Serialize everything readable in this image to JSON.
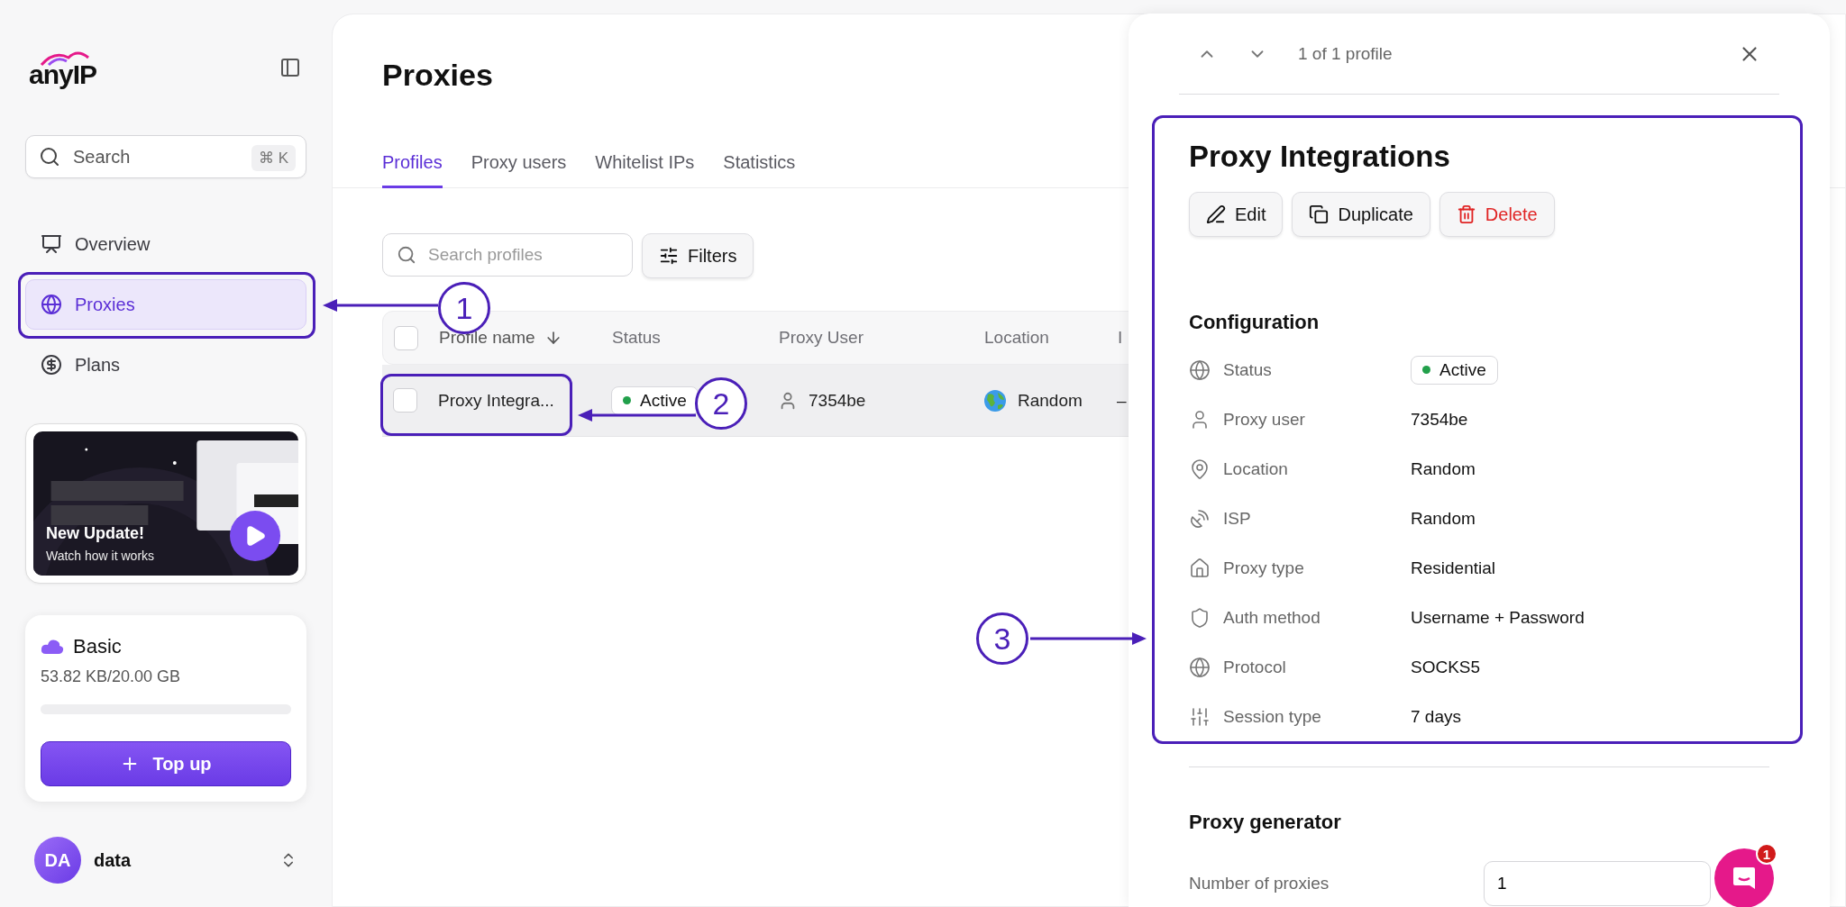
{
  "sidebar": {
    "logo": "anyIP",
    "search": {
      "placeholder": "Search",
      "shortcut": "⌘ K"
    },
    "nav": [
      {
        "label": "Overview",
        "selected": false
      },
      {
        "label": "Proxies",
        "selected": true
      },
      {
        "label": "Plans",
        "selected": false
      }
    ],
    "promo": {
      "title": "New Update!",
      "subtitle": "Watch how it works"
    },
    "plan": {
      "name": "Basic",
      "usage": "53.82 KB/20.00 GB",
      "level": 0,
      "button": "Top up"
    },
    "user": {
      "initials": "DA",
      "name": "data"
    }
  },
  "page": {
    "title": "Proxies",
    "tabs": [
      {
        "label": "Profiles",
        "selected": true
      },
      {
        "label": "Proxy users",
        "selected": false
      },
      {
        "label": "Whitelist IPs",
        "selected": false
      },
      {
        "label": "Statistics",
        "selected": false
      }
    ],
    "search": {
      "placeholder": "Search profiles"
    },
    "filters_button": "Filters",
    "table": {
      "all_checked": false,
      "columns": [
        {
          "label": "Profile name",
          "sorted": true
        },
        {
          "label": "Status",
          "sorted": false
        },
        {
          "label": "Proxy User",
          "sorted": false
        },
        {
          "label": "Location",
          "sorted": false
        },
        {
          "label": "I",
          "sorted": false
        }
      ],
      "rows": [
        {
          "checked": false,
          "name": "Proxy Integra...",
          "status": "Active",
          "proxy_user": "7354be",
          "location": "Random",
          "column_5": "–"
        }
      ]
    }
  },
  "drawer": {
    "position": "1 of 1 profile",
    "title": "Proxy Integrations",
    "actions": [
      {
        "label": "Edit",
        "kind": "edit"
      },
      {
        "label": "Duplicate",
        "kind": "duplicate"
      },
      {
        "label": "Delete",
        "kind": "delete"
      }
    ],
    "configuration": {
      "heading": "Configuration",
      "rows": [
        {
          "label": "Status",
          "value": "Active",
          "kind": "badge",
          "color": "#22a04b"
        },
        {
          "label": "Proxy user",
          "value": "7354be",
          "kind": "text"
        },
        {
          "label": "Location",
          "value": "Random",
          "kind": "text"
        },
        {
          "label": "ISP",
          "value": "Random",
          "kind": "text"
        },
        {
          "label": "Proxy type",
          "value": "Residential",
          "kind": "text"
        },
        {
          "label": "Auth method",
          "value": "Username + Password",
          "kind": "text"
        },
        {
          "label": "Protocol",
          "value": "SOCKS5",
          "kind": "text"
        },
        {
          "label": "Session type",
          "value": "7 days",
          "kind": "text"
        }
      ]
    },
    "generator": {
      "heading": "Proxy generator",
      "fields": [
        {
          "label": "Number of proxies",
          "value": "1"
        }
      ]
    }
  },
  "chat": {
    "badge": "1"
  },
  "annotations": [
    {
      "number": "1"
    },
    {
      "number": "2"
    },
    {
      "number": "3"
    }
  ]
}
